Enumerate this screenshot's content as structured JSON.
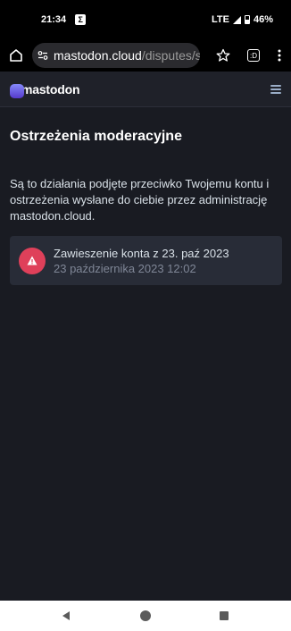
{
  "status_bar": {
    "time": "21:34",
    "app_icon": "Σ",
    "network": "LTE",
    "battery": "46%"
  },
  "browser": {
    "url_domain": "mastodon.cloud",
    "url_path": "/disputes/s",
    "tabs_count": ":D"
  },
  "header": {
    "logo_text": "mastodon"
  },
  "page": {
    "title": "Ostrzeżenia moderacyjne",
    "intro": "Są to działania podjęte przeciwko Twojemu kontu i ostrzeżenia wysłane do ciebie przez administrację mastodon.cloud."
  },
  "strikes": [
    {
      "title": "Zawieszenie konta z 23. paź 2023",
      "date": "23 października 2023 12:02"
    }
  ],
  "colors": {
    "background": "#191b22",
    "card": "#282c37",
    "warning": "#df405a",
    "brand": "#6364ff"
  }
}
